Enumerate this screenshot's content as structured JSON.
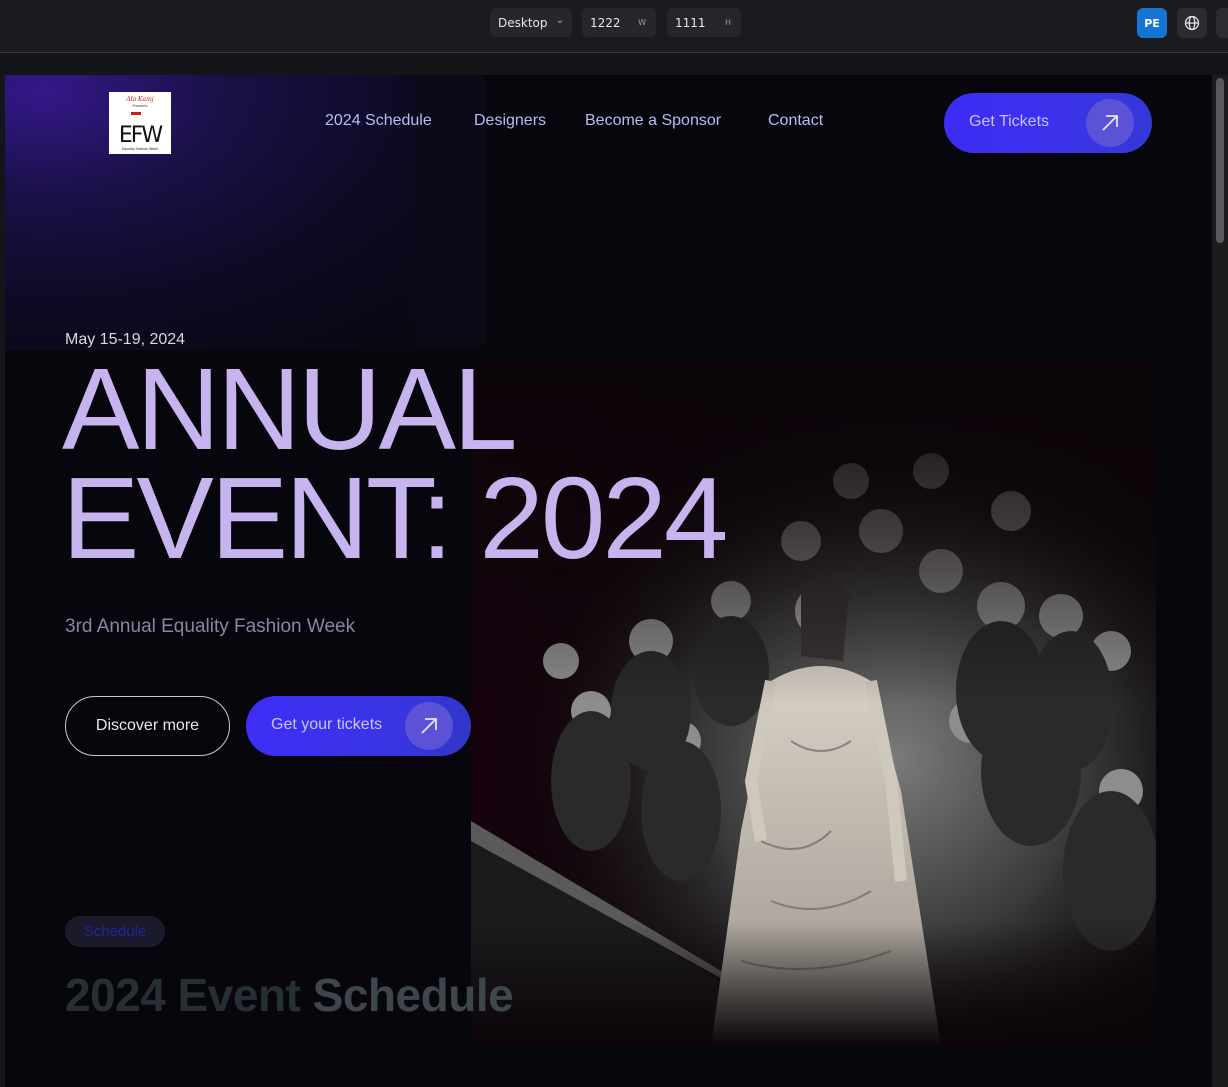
{
  "editor": {
    "device": "Desktop",
    "width": "1222",
    "width_unit": "W",
    "height": "1111",
    "height_unit": "H",
    "user_initials": "PE"
  },
  "site": {
    "logo": {
      "script_text": "Ala Kamj",
      "sub_text": "Presents",
      "letters": "EFW",
      "caption": "Equality Fashion Week"
    },
    "nav": [
      "2024 Schedule",
      "Designers",
      "Become a Sponsor",
      "Contact"
    ],
    "header_cta": "Get Tickets",
    "hero": {
      "date": "May 15-19, 2024",
      "title_line1": "ANNUAL",
      "title_line2": "EVENT: 2024",
      "subtitle": "3rd Annual Equality Fashion Week",
      "discover_label": "Discover more",
      "tickets_label": "Get your tickets"
    },
    "schedule": {
      "chip": "Schedule",
      "title_part1": "2024 Event ",
      "title_part2": "Schedule"
    }
  },
  "colors": {
    "accent": "#3d2cf5",
    "title": "#c7b3ee",
    "nav": "#b4bdf7"
  }
}
